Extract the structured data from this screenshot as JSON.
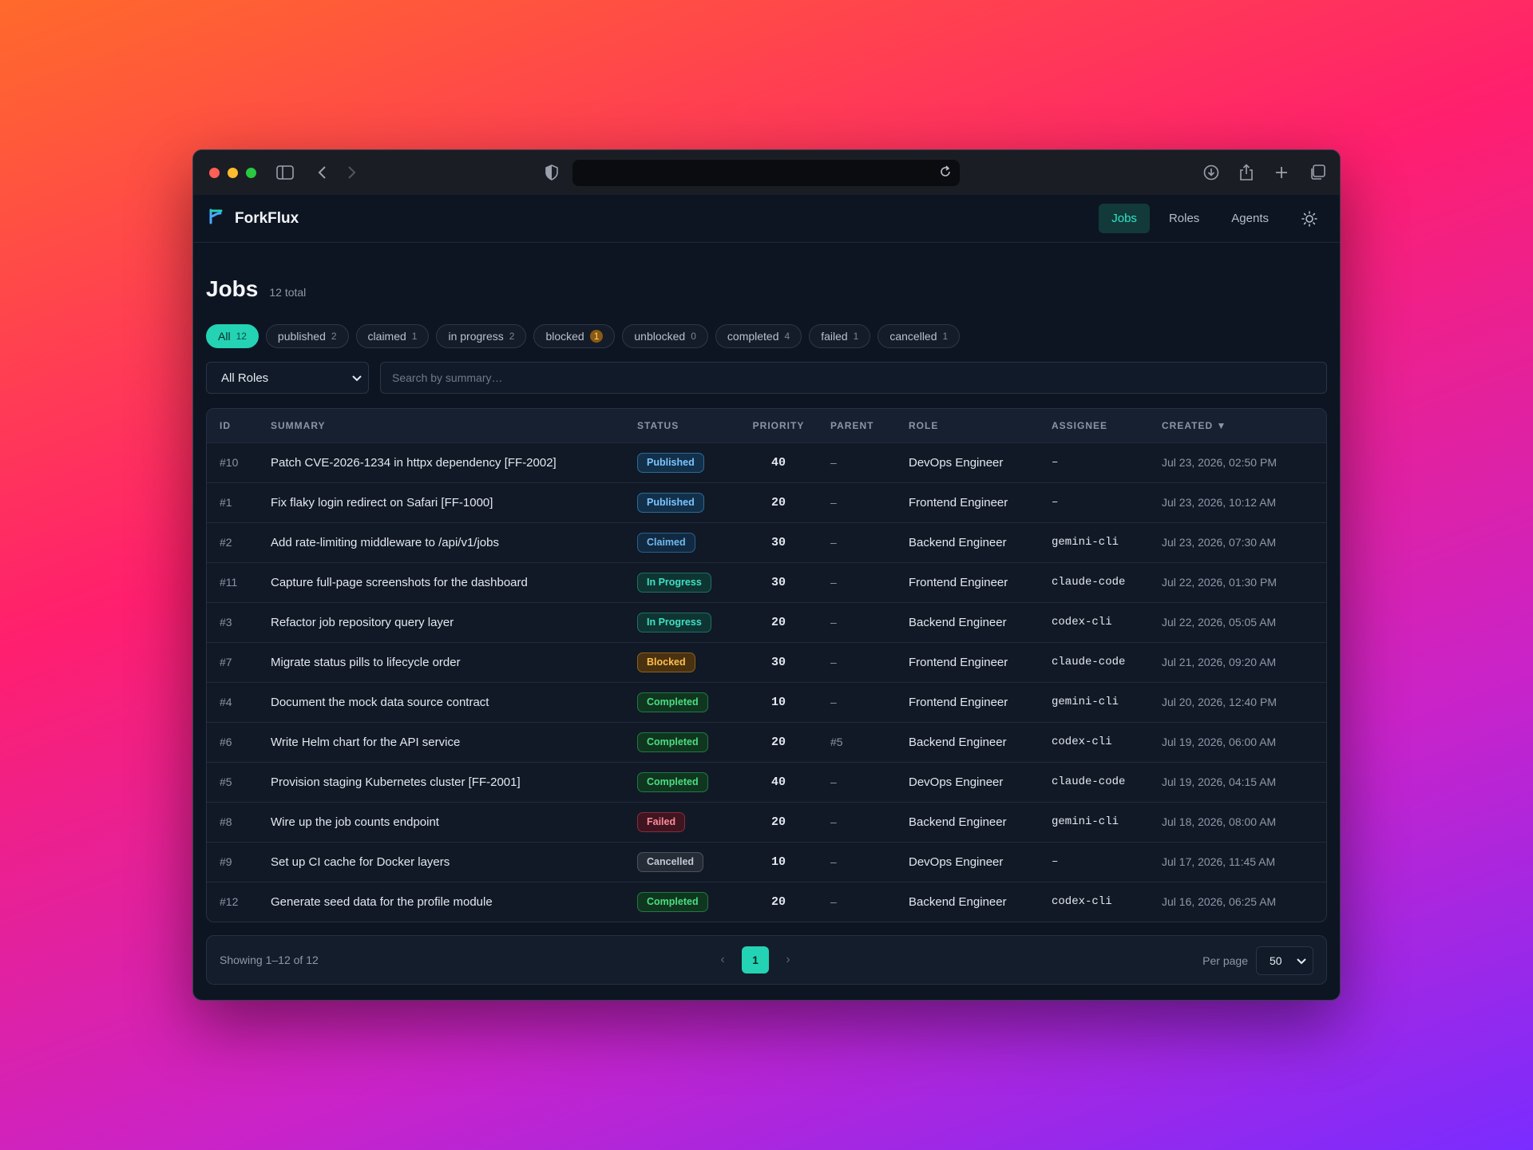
{
  "app": {
    "title": "ForkFlux"
  },
  "colors": {
    "accent": "#24d3b3",
    "background": "#0e1522"
  },
  "nav": {
    "items": [
      {
        "label": "Jobs",
        "active": true
      },
      {
        "label": "Roles",
        "active": false
      },
      {
        "label": "Agents",
        "active": false
      }
    ]
  },
  "page": {
    "title": "Jobs",
    "total": "12 total"
  },
  "filters": {
    "pills": [
      {
        "label": "All",
        "count": "12"
      },
      {
        "label": "published",
        "count": "2"
      },
      {
        "label": "claimed",
        "count": "1"
      },
      {
        "label": "in progress",
        "count": "2"
      },
      {
        "label": "blocked",
        "count": "1"
      },
      {
        "label": "unblocked",
        "count": "0"
      },
      {
        "label": "completed",
        "count": "4"
      },
      {
        "label": "failed",
        "count": "1"
      },
      {
        "label": "cancelled",
        "count": "1"
      }
    ],
    "role_select": "All Roles",
    "search_placeholder": "Search by summary…"
  },
  "table": {
    "headers": [
      "ID",
      "SUMMARY",
      "STATUS",
      "PRIORITY",
      "PARENT",
      "ROLE",
      "ASSIGNEE",
      "CREATED ▼"
    ],
    "rows": [
      {
        "id": "#10",
        "summary": "Patch CVE-2026-1234 in httpx dependency [FF-2002]",
        "status": "Published",
        "priority": "40",
        "parent": "–",
        "role": "DevOps Engineer",
        "assignee": "–",
        "created": "Jul 23, 2026, 02:50 PM"
      },
      {
        "id": "#1",
        "summary": "Fix flaky login redirect on Safari [FF-1000]",
        "status": "Published",
        "priority": "20",
        "parent": "–",
        "role": "Frontend Engineer",
        "assignee": "–",
        "created": "Jul 23, 2026, 10:12 AM"
      },
      {
        "id": "#2",
        "summary": "Add rate-limiting middleware to /api/v1/jobs",
        "status": "Claimed",
        "priority": "30",
        "parent": "–",
        "role": "Backend Engineer",
        "assignee": "gemini-cli",
        "created": "Jul 23, 2026, 07:30 AM"
      },
      {
        "id": "#11",
        "summary": "Capture full-page screenshots for the dashboard",
        "status": "In Progress",
        "priority": "30",
        "parent": "–",
        "role": "Frontend Engineer",
        "assignee": "claude-code",
        "created": "Jul 22, 2026, 01:30 PM"
      },
      {
        "id": "#3",
        "summary": "Refactor job repository query layer",
        "status": "In Progress",
        "priority": "20",
        "parent": "–",
        "role": "Backend Engineer",
        "assignee": "codex-cli",
        "created": "Jul 22, 2026, 05:05 AM"
      },
      {
        "id": "#7",
        "summary": "Migrate status pills to lifecycle order",
        "status": "Blocked",
        "priority": "30",
        "parent": "–",
        "role": "Frontend Engineer",
        "assignee": "claude-code",
        "created": "Jul 21, 2026, 09:20 AM"
      },
      {
        "id": "#4",
        "summary": "Document the mock data source contract",
        "status": "Completed",
        "priority": "10",
        "parent": "–",
        "role": "Frontend Engineer",
        "assignee": "gemini-cli",
        "created": "Jul 20, 2026, 12:40 PM"
      },
      {
        "id": "#6",
        "summary": "Write Helm chart for the API service",
        "status": "Completed",
        "priority": "20",
        "parent": "#5",
        "role": "Backend Engineer",
        "assignee": "codex-cli",
        "created": "Jul 19, 2026, 06:00 AM"
      },
      {
        "id": "#5",
        "summary": "Provision staging Kubernetes cluster [FF-2001]",
        "status": "Completed",
        "priority": "40",
        "parent": "–",
        "role": "DevOps Engineer",
        "assignee": "claude-code",
        "created": "Jul 19, 2026, 04:15 AM"
      },
      {
        "id": "#8",
        "summary": "Wire up the job counts endpoint",
        "status": "Failed",
        "priority": "20",
        "parent": "–",
        "role": "Backend Engineer",
        "assignee": "gemini-cli",
        "created": "Jul 18, 2026, 08:00 AM"
      },
      {
        "id": "#9",
        "summary": "Set up CI cache for Docker layers",
        "status": "Cancelled",
        "priority": "10",
        "parent": "–",
        "role": "DevOps Engineer",
        "assignee": "–",
        "created": "Jul 17, 2026, 11:45 AM"
      },
      {
        "id": "#12",
        "summary": "Generate seed data for the profile module",
        "status": "Completed",
        "priority": "20",
        "parent": "–",
        "role": "Backend Engineer",
        "assignee": "codex-cli",
        "created": "Jul 16, 2026, 06:25 AM"
      }
    ]
  },
  "footer": {
    "showing": "Showing 1–12 of 12",
    "current_page": "1",
    "per_page_label": "Per page",
    "per_page_value": "50"
  },
  "icons": {
    "sidebar": "sidebar-icon",
    "back": "chevron-left-icon",
    "forward": "chevron-right-icon",
    "shield": "shield-icon",
    "reload": "reload-icon",
    "download": "download-icon",
    "share": "share-icon",
    "new_tab": "plus-icon",
    "tabs": "tabs-icon",
    "logo": "forkflux-logo-icon",
    "theme": "sun-icon"
  }
}
